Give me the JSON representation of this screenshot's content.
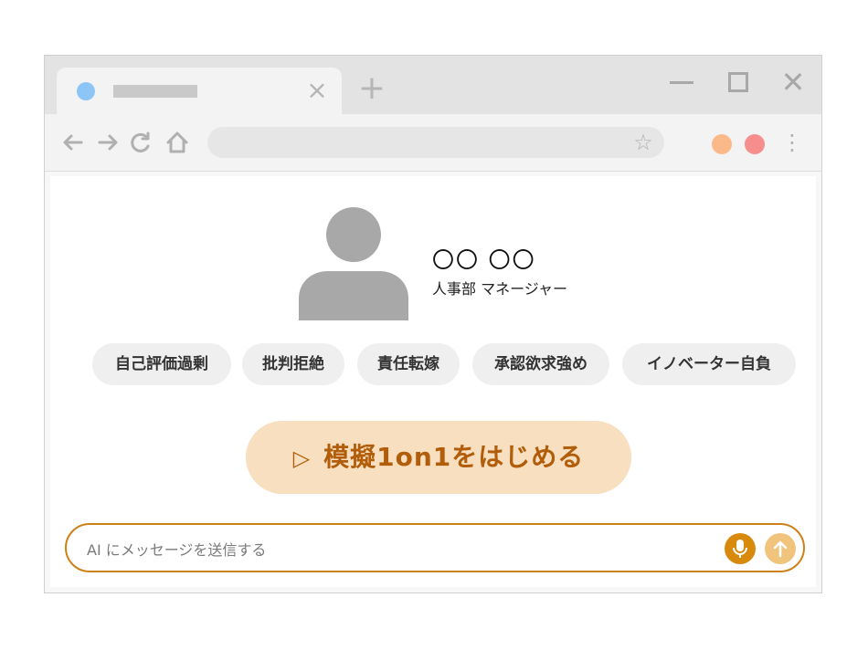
{
  "browser": {
    "tab": {
      "favicon_color": "#8ec5f7",
      "close_icon": "close-icon"
    },
    "window_controls": [
      "minimize-icon",
      "maximize-icon",
      "close-icon"
    ],
    "nav_icons": [
      "back-arrow-icon",
      "forward-arrow-icon",
      "reload-icon",
      "home-icon"
    ],
    "extension_colors": [
      "#fbb98a",
      "#f68e8e"
    ]
  },
  "profile": {
    "name": "〇〇 〇〇",
    "role": "人事部 マネージャー",
    "avatar_color": "#a8a8a8"
  },
  "tags": [
    "自己評価過剰",
    "批判拒絶",
    "責任転嫁",
    "承認欲求強め",
    "イノベーター自負"
  ],
  "start_button": {
    "label": "模擬1on1をはじめる",
    "icon": "play-icon"
  },
  "chat": {
    "placeholder": "AI にメッセージを送信する",
    "mic_icon": "microphone-icon",
    "send_icon": "arrow-up-icon"
  },
  "colors": {
    "accent": "#d88a0f",
    "accent_light": "#f8dfc0",
    "start_text": "#b15d0a",
    "send_disabled": "#f0c47d"
  }
}
